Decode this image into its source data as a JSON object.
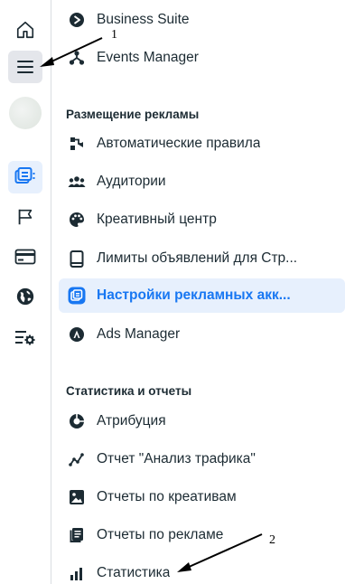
{
  "rail": {
    "items": [
      {
        "icon": "home-icon",
        "active": false
      },
      {
        "icon": "hamburger-menu-icon",
        "active": false
      },
      {
        "icon": "avatar"
      },
      {
        "icon": "ad-account-settings-icon",
        "active": true
      },
      {
        "icon": "flag-icon",
        "active": false
      },
      {
        "icon": "credit-card-icon",
        "active": false
      },
      {
        "icon": "globe-icon",
        "active": false
      },
      {
        "icon": "settings-list-icon",
        "active": false
      }
    ]
  },
  "menu": {
    "top_items": [
      {
        "label": "Business Suite",
        "icon": "business-suite-icon"
      },
      {
        "label": "Events Manager",
        "icon": "events-manager-icon"
      }
    ],
    "sections": [
      {
        "title": "Размещение рекламы",
        "items": [
          {
            "label": "Автоматические правила",
            "icon": "automated-rules-icon"
          },
          {
            "label": "Аудитории",
            "icon": "audiences-icon"
          },
          {
            "label": "Креативный центр",
            "icon": "palette-icon"
          },
          {
            "label": "Лимиты объявлений для Стр...",
            "icon": "tablet-icon"
          },
          {
            "label": "Настройки рекламных акк...",
            "icon": "ad-account-settings-icon",
            "active": true
          },
          {
            "label": "Ads Manager",
            "icon": "ads-manager-icon"
          }
        ]
      },
      {
        "title": "Статистика и отчеты",
        "items": [
          {
            "label": "Атрибуция",
            "icon": "attribution-icon"
          },
          {
            "label": "Отчет \"Анализ трафика\"",
            "icon": "traffic-analysis-icon"
          },
          {
            "label": "Отчеты по креативам",
            "icon": "image-icon"
          },
          {
            "label": "Отчеты по рекламе",
            "icon": "ads-reports-icon"
          },
          {
            "label": "Статистика",
            "icon": "bar-chart-icon"
          }
        ]
      }
    ]
  },
  "annotations": {
    "label_1": "1",
    "label_2": "2"
  },
  "colors": {
    "accent": "#1877f2",
    "active_bg": "#e7f0fd",
    "text": "#1c2b33",
    "divider": "#dadde1"
  }
}
